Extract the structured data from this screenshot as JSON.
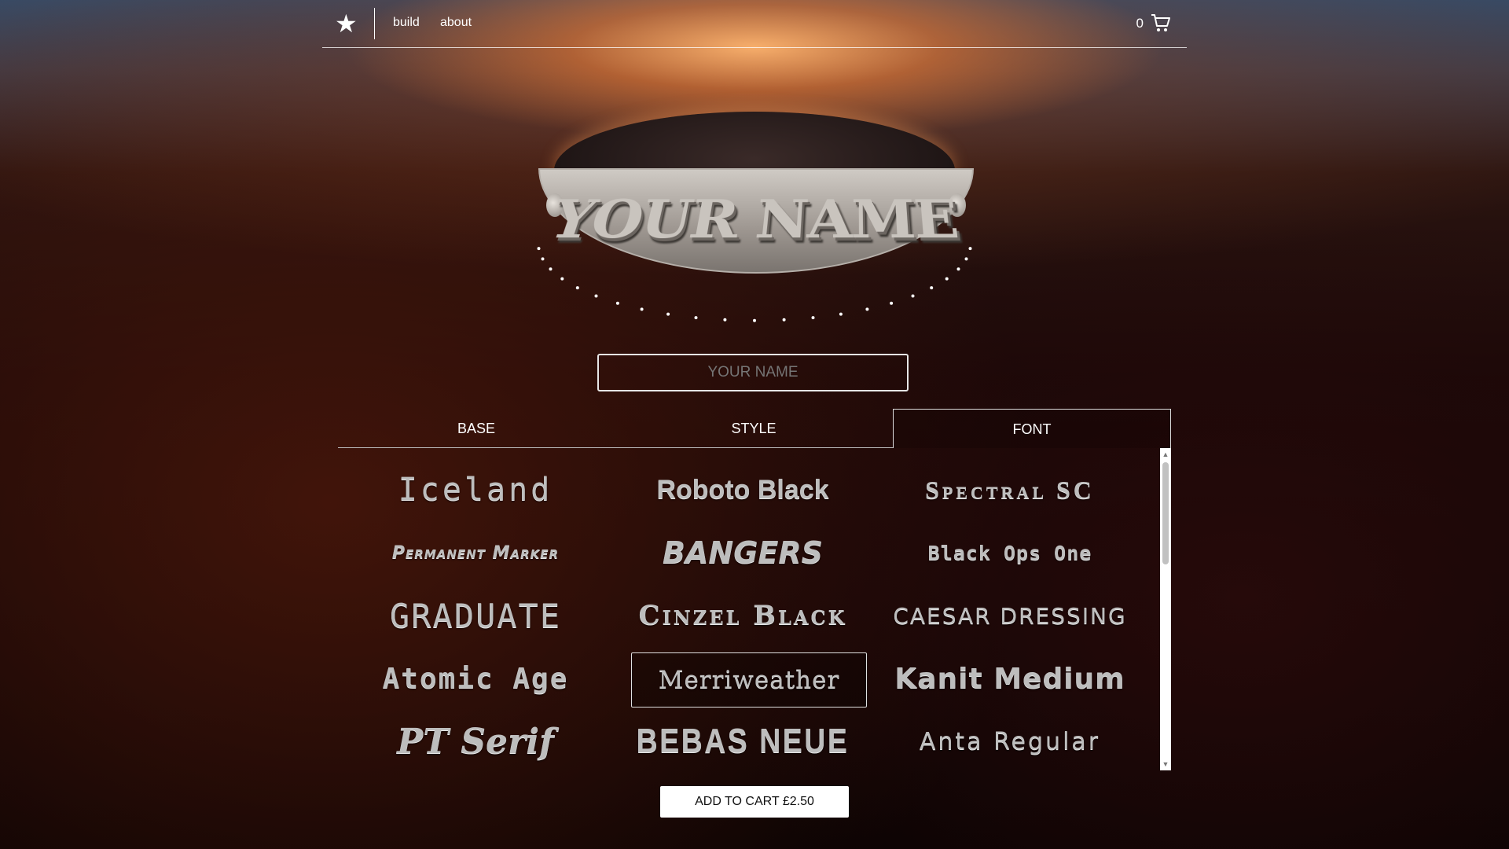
{
  "nav": {
    "logo_icon": "star-icon",
    "links": [
      "build",
      "about"
    ],
    "cart_count": "0",
    "cart_icon": "cart-icon"
  },
  "preview": {
    "plate_text": "YOUR NAME"
  },
  "name_input": {
    "placeholder": "YOUR NAME"
  },
  "tabs": [
    {
      "label": "BASE",
      "active": false
    },
    {
      "label": "STYLE",
      "active": false
    },
    {
      "label": "FONT",
      "active": true
    }
  ],
  "fonts": [
    "Iceland",
    "Roboto Black",
    "Spectral SC",
    "Permanent Marker",
    "Bangers",
    "Black Ops One",
    "GRADUATE",
    "Cinzel Black",
    "Caesar Dressing",
    "Atomic Age",
    "Merriweather",
    "Kanit Medium",
    "PT Serif",
    "BEBAS NEUE",
    "Anta Regular"
  ],
  "selected_font": "Merriweather",
  "add_to_cart": "ADD TO CART £2.50"
}
